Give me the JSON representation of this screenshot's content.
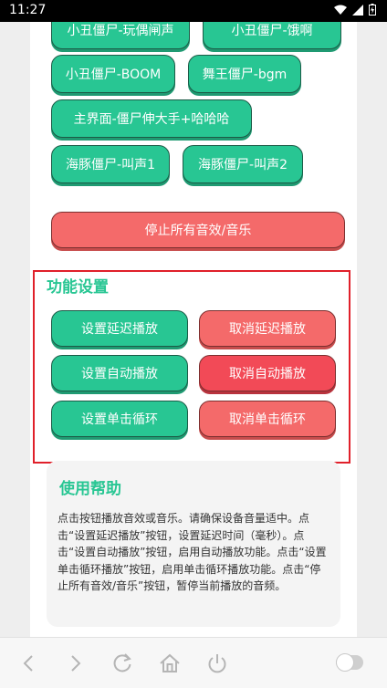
{
  "status": {
    "time": "11:27"
  },
  "sound_buttons": [
    "小丑僵尸-玩偶闸声",
    "小丑僵尸-饿啊",
    "小丑僵尸-BOOM",
    "舞王僵尸-bgm",
    "主界面-僵尸伸大手+哈哈哈",
    "海豚僵尸-叫声1",
    "海豚僵尸-叫声2"
  ],
  "stop_all": "停止所有音效/音乐",
  "settings": {
    "title": "功能设置",
    "set_delay": "设置延迟播放",
    "cancel_delay": "取消延迟播放",
    "set_auto": "设置自动播放",
    "cancel_auto": "取消自动播放",
    "set_loop": "设置单击循环",
    "cancel_loop": "取消单击循环"
  },
  "help": {
    "title": "使用帮助",
    "text": "点击按钮播放音效或音乐。请确保设备音量适中。点击“设置延迟播放”按钮，设置延迟时间（毫秒）。点击“设置自动播放”按钮，启用自动播放功能。点击“设置单击循环播放”按钮，启用单击循环播放功能。点击“停止所有音效/音乐”按钮，暂停当前播放的音频。"
  },
  "colors": {
    "green": "#28c693",
    "red": "#f46a6a",
    "red_strong": "#f24a57",
    "highlight": "#e0202a"
  },
  "nav_icons": [
    "back-icon",
    "forward-icon",
    "refresh-icon",
    "home-icon",
    "power-icon",
    "toggle"
  ]
}
